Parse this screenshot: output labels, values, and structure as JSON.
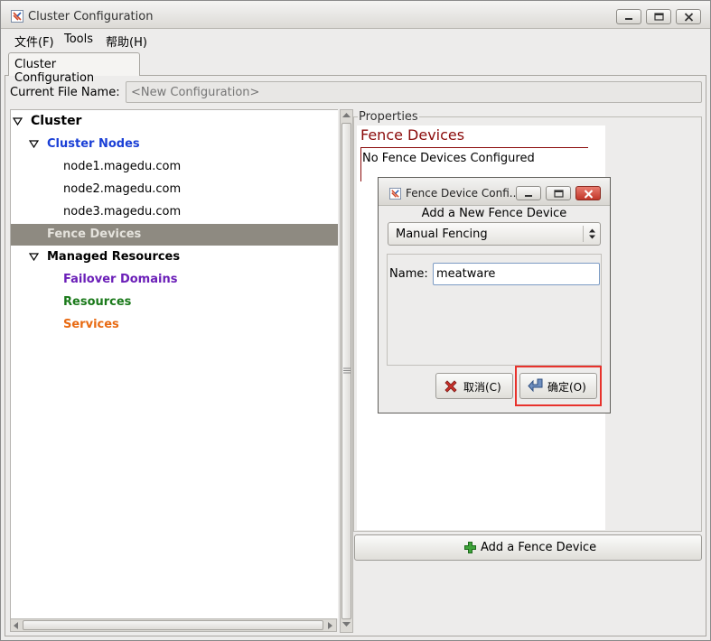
{
  "window": {
    "title": "Cluster Configuration"
  },
  "menu": [
    "文件(F)",
    "Tools",
    "帮助(H)"
  ],
  "tab": {
    "label": "Cluster Configuration"
  },
  "file": {
    "label": "Current File Name:",
    "placeholder": "<New Configuration>"
  },
  "tree": {
    "cluster": "Cluster",
    "cluster_nodes": "Cluster Nodes",
    "nodes": [
      "node1.magedu.com",
      "node2.magedu.com",
      "node3.magedu.com"
    ],
    "fence_devices": "Fence Devices",
    "managed_resources": "Managed Resources",
    "failover_domains": "Failover Domains",
    "resources": "Resources",
    "services": "Services"
  },
  "properties": {
    "legend": "Properties",
    "heading": "Fence Devices",
    "empty_text": "No Fence Devices Configured",
    "add_button": "Add a Fence Device"
  },
  "dialog": {
    "title": "Fence Device Confi...",
    "subtitle": "Add a New Fence Device",
    "type_selected": "Manual Fencing",
    "name_label": "Name:",
    "name_value": "meatware",
    "cancel_label": "取消(C)",
    "ok_label": "确定(O)"
  },
  "colors": {
    "cluster_nodes": "#1a3fd6",
    "failover_domains": "#6b1fb8",
    "resources": "#1b7a1b",
    "services": "#e86a12",
    "fence_heading": "#8b0b0b",
    "selected_row": "#8e8a81",
    "highlight": "#e8322c"
  }
}
